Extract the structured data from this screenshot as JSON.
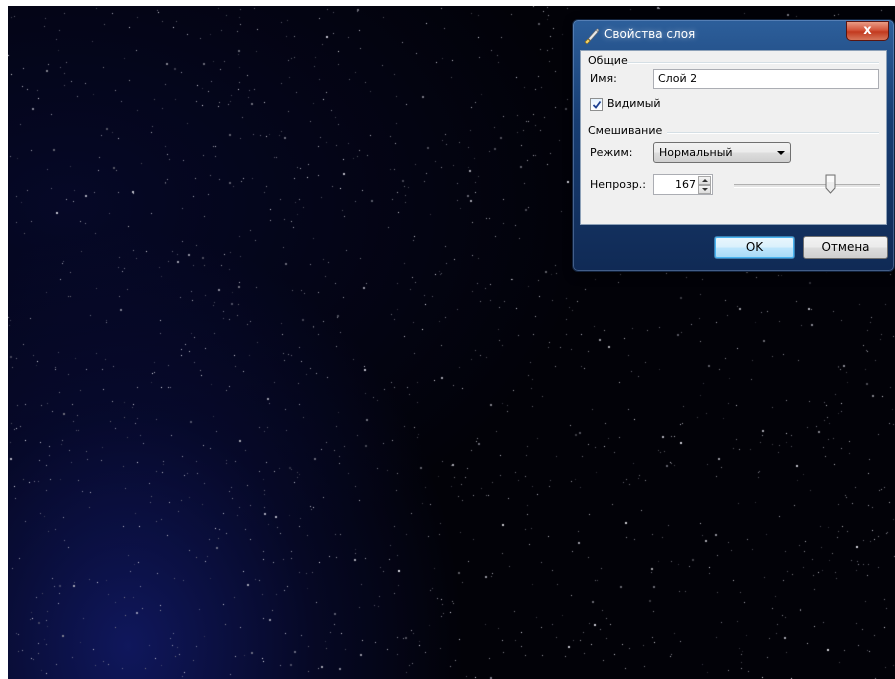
{
  "dialog": {
    "title": "Свойства слоя",
    "close_glyph": "x",
    "icon": "brush-icon",
    "general": {
      "section_label": "Общие",
      "name_label": "Имя:",
      "name_value": "Слой 2",
      "visible_label": "Видимый",
      "visible_checked": true
    },
    "blending": {
      "section_label": "Смешивание",
      "mode_label": "Режим:",
      "mode_value": "Нормальный",
      "opacity_label": "Непрозр.:",
      "opacity_value": "167",
      "opacity_fraction": 0.655
    },
    "buttons": {
      "ok_label": "OK",
      "cancel_label": "Отмена"
    }
  },
  "colors": {
    "titlebar": "#1f4a82",
    "close_button": "#c9472b",
    "client_bg": "#f0f0f0",
    "background": "#020208"
  }
}
